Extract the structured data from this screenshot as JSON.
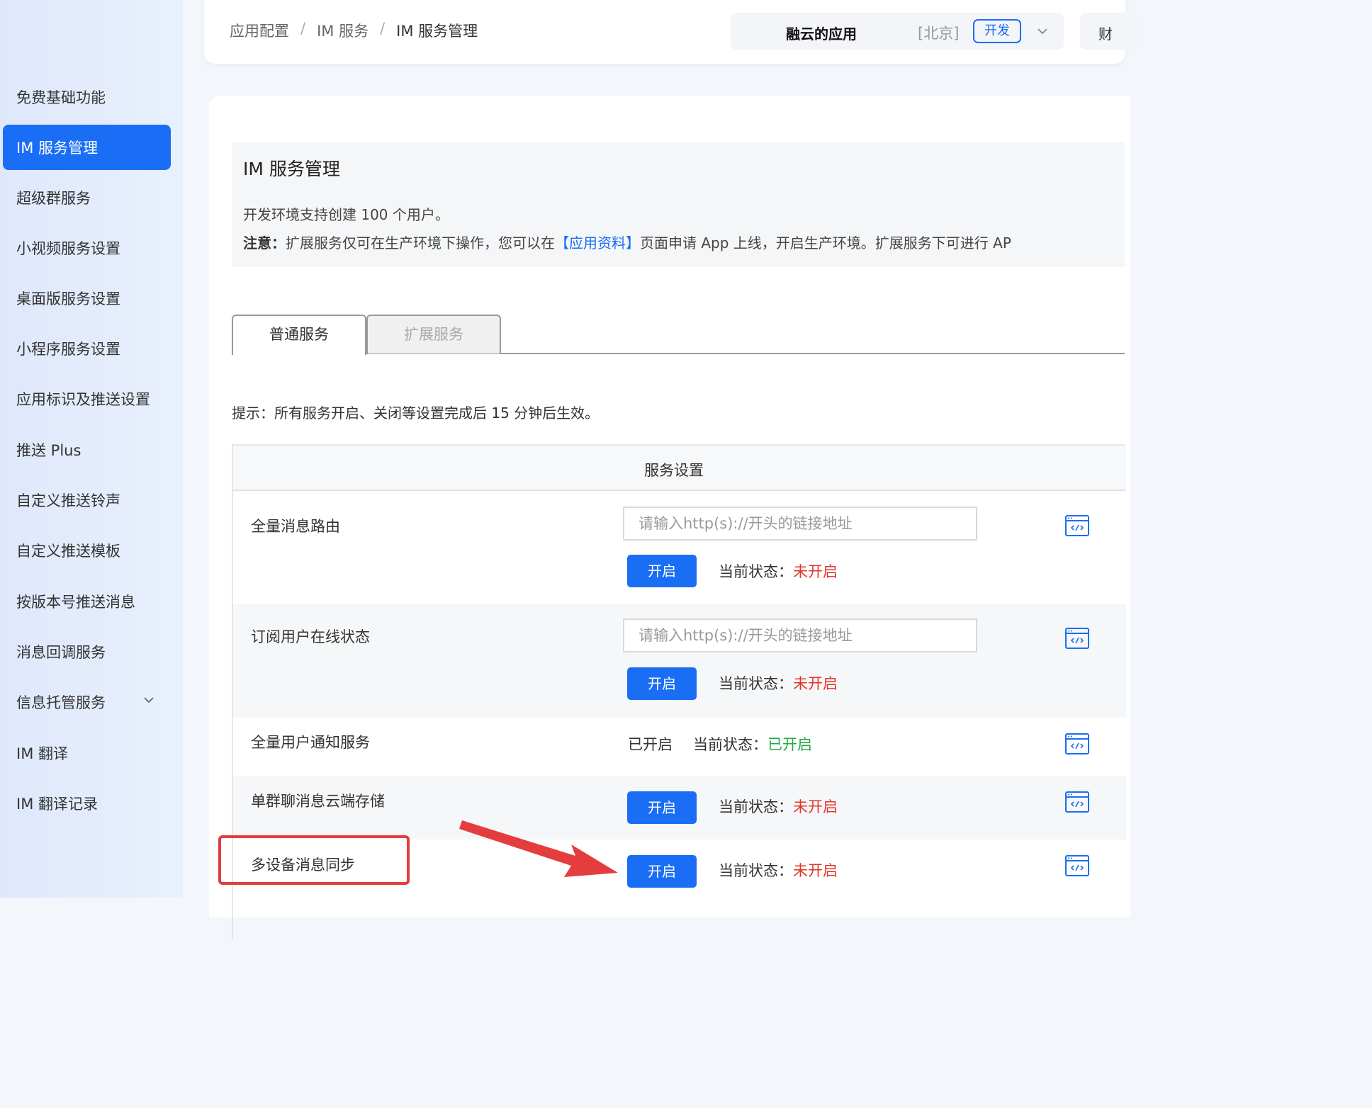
{
  "sidebar": {
    "items": [
      {
        "label": "免费基础功能"
      },
      {
        "label": "IM 服务管理",
        "active": true
      },
      {
        "label": "超级群服务"
      },
      {
        "label": "小视频服务设置"
      },
      {
        "label": "桌面版服务设置"
      },
      {
        "label": "小程序服务设置"
      },
      {
        "label": "应用标识及推送设置"
      },
      {
        "label": "推送 Plus"
      },
      {
        "label": "自定义推送铃声"
      },
      {
        "label": "自定义推送模板"
      },
      {
        "label": "按版本号推送消息"
      },
      {
        "label": "消息回调服务"
      },
      {
        "label": "信息托管服务",
        "expandable": true
      },
      {
        "label": "IM 翻译"
      },
      {
        "label": "IM 翻译记录"
      }
    ]
  },
  "header": {
    "breadcrumb": [
      "应用配置",
      "IM 服务",
      "IM 服务管理"
    ],
    "breadcrumb_sep": "/",
    "app_name": "融云的应用",
    "region": "[北京]",
    "env_badge": "开发",
    "next_tab": "财"
  },
  "notice": {
    "title": "IM 服务管理",
    "line1": "开发环境支持创建 100 个用户。",
    "line2_strong": "注意：",
    "line2_before": "扩展服务仅可在生产环境下操作，您可以在",
    "line2_link": "【应用资料】",
    "line2_after": "页面申请 App 上线，开启生产环境。扩展服务下可进行 AP"
  },
  "tabs": [
    {
      "label": "普通服务",
      "active": true
    },
    {
      "label": "扩展服务",
      "active": false
    }
  ],
  "hint": "提示：所有服务开启、关闭等设置完成后 15 分钟后生效。",
  "table": {
    "header": "服务设置",
    "status_prefix": "当前状态：",
    "rows": [
      {
        "label": "全量消息路由",
        "placeholder": "请输入http(s)://开头的链接地址",
        "button": "开启",
        "status": "未开启"
      },
      {
        "label": "订阅用户在线状态",
        "placeholder": "请输入http(s)://开头的链接地址",
        "button": "开启",
        "status": "未开启"
      },
      {
        "label": "全量用户通知服务",
        "enabled_text": "已开启",
        "status": "已开启"
      },
      {
        "label": "单群聊消息云端存储",
        "button": "开启",
        "status": "未开启"
      },
      {
        "label": "多设备消息同步",
        "button": "开启",
        "status": "未开启"
      }
    ]
  },
  "colors": {
    "accent": "#1a6ef5",
    "status_off": "#e0352b",
    "status_on": "#27a844",
    "annotation": "#e43d3d"
  },
  "icons": {
    "api_doc": "api-doc-icon",
    "chevron": "chevron-down-icon"
  }
}
